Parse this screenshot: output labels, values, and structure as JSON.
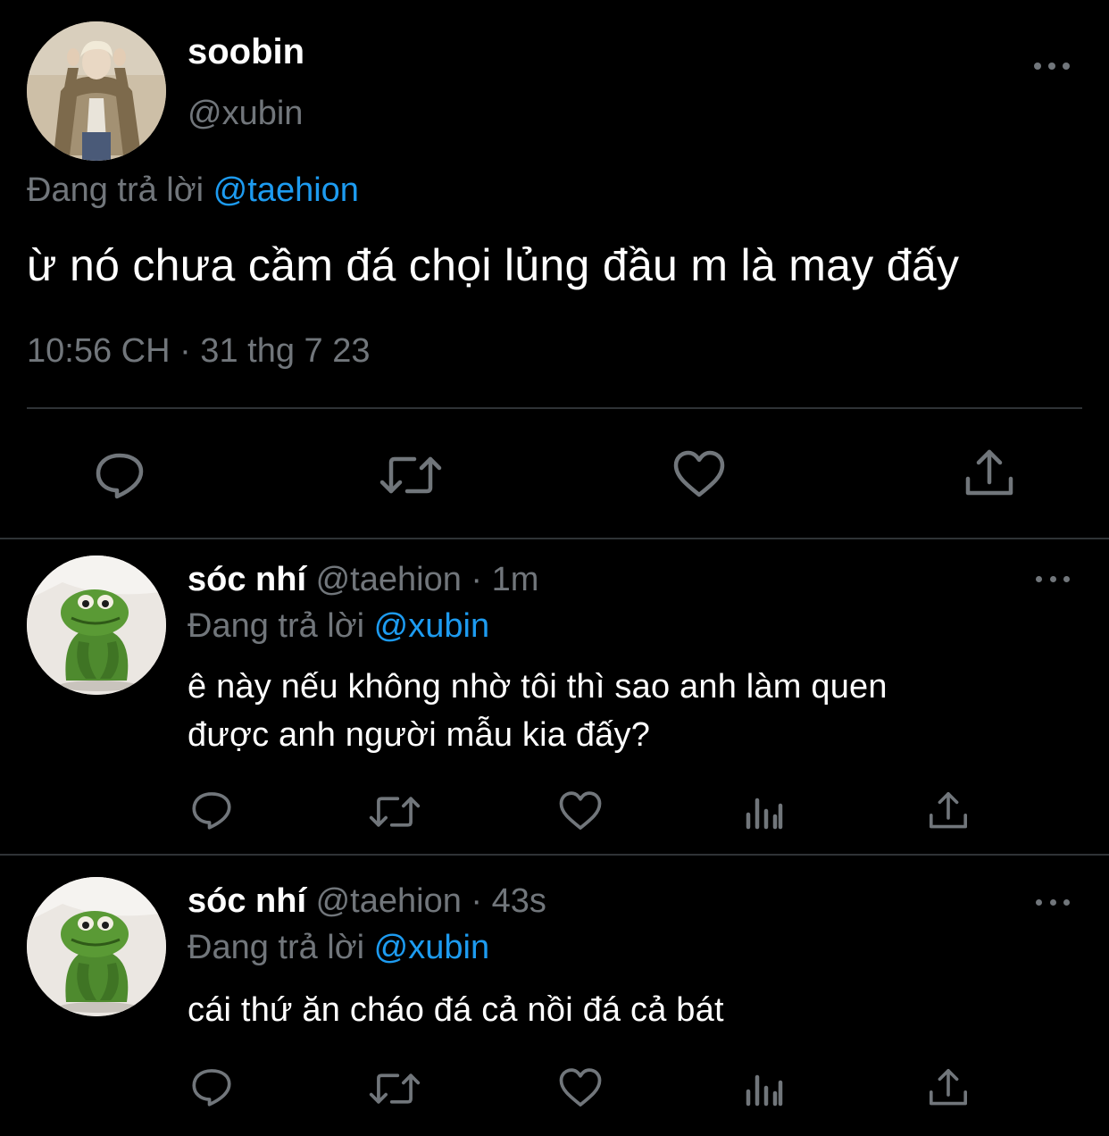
{
  "main_tweet": {
    "display_name": "soobin",
    "handle": "@xubin",
    "replying_prefix": "Đang trả lời",
    "replying_to": "@taehion",
    "text": "ừ nó chưa cầm đá chọi lủng đầu m là may đấy",
    "timestamp": "10:56 CH · 31 thg 7 23",
    "avatar_icon": "user-photo",
    "actions": [
      "reply-icon",
      "retweet-icon",
      "like-icon",
      "share-icon"
    ]
  },
  "replies": [
    {
      "display_name": "sóc nhí",
      "handle": "@taehion",
      "separator": "·",
      "time_ago": "1m",
      "replying_prefix": "Đang trả lời",
      "replying_to": "@xubin",
      "text_line1": "ê này nếu không nhờ tôi thì sao anh làm quen",
      "text_line2": "được anh người mẫu kia đấy?",
      "avatar_icon": "green-frog-photo",
      "actions": [
        "reply-icon",
        "retweet-icon",
        "like-icon",
        "views-icon",
        "share-icon"
      ]
    },
    {
      "display_name": "sóc nhí",
      "handle": "@taehion",
      "separator": "·",
      "time_ago": "43s",
      "replying_prefix": "Đang trả lời",
      "replying_to": "@xubin",
      "text_line1": "cái thứ ăn cháo đá cả nồi đá cả bát",
      "avatar_icon": "green-frog-photo",
      "actions": [
        "reply-icon",
        "retweet-icon",
        "like-icon",
        "views-icon",
        "share-icon"
      ]
    }
  ],
  "colors": {
    "background": "#000000",
    "text_primary": "#ffffff",
    "text_secondary": "#71767b",
    "accent_link": "#1d9bf0",
    "divider": "#2f3336"
  }
}
